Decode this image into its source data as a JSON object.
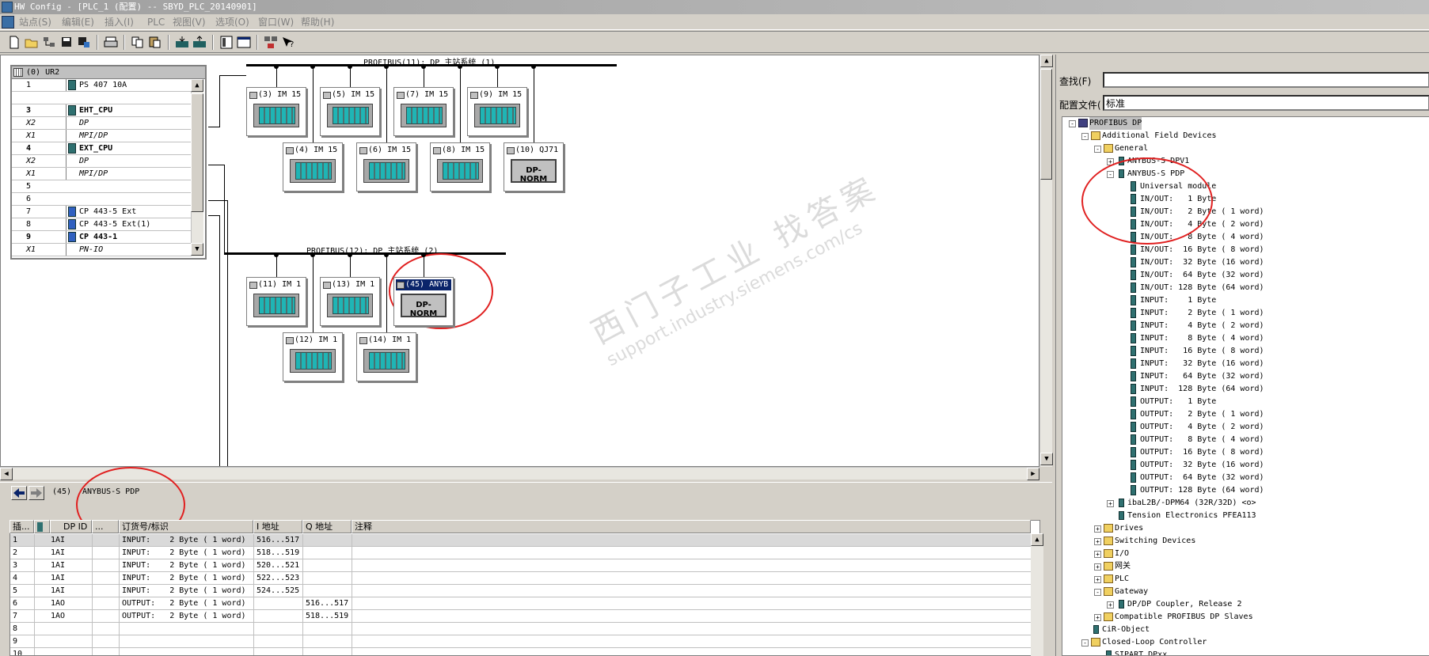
{
  "window": {
    "title": "HW Config - [PLC_1 (配置) -- SBYD_PLC_20140901]"
  },
  "menu": [
    {
      "id": "station",
      "label": "站点(S)"
    },
    {
      "id": "edit",
      "label": "编辑(E)"
    },
    {
      "id": "insert",
      "label": "插入(I)"
    },
    {
      "id": "plc",
      "label": "PLC"
    },
    {
      "id": "view",
      "label": "视图(V)"
    },
    {
      "id": "options",
      "label": "选项(O)"
    },
    {
      "id": "window",
      "label": "窗口(W)"
    },
    {
      "id": "help",
      "label": "帮助(H)"
    }
  ],
  "rack": {
    "title": "(0) UR2",
    "rows": [
      {
        "slot": "1",
        "module": "PS 407 10A"
      },
      {
        "slot": "",
        "module": ""
      },
      {
        "slot": "3",
        "module": "EHT_CPU"
      },
      {
        "slot": "X2",
        "module": "DP"
      },
      {
        "slot": "X1",
        "module": "MPI/DP"
      },
      {
        "slot": "4",
        "module": "EXT_CPU"
      },
      {
        "slot": "X2",
        "module": "DP"
      },
      {
        "slot": "X1",
        "module": "MPI/DP"
      },
      {
        "slot": "5",
        "module": ""
      },
      {
        "slot": "6",
        "module": ""
      },
      {
        "slot": "7",
        "module": "CP 443-5 Ext"
      },
      {
        "slot": "8",
        "module": "CP 443-5 Ext(1)"
      },
      {
        "slot": "9",
        "module": "CP 443-1"
      },
      {
        "slot": "X1",
        "module": "PN-IO"
      }
    ]
  },
  "bus1": {
    "label": "PROFIBUS(11): DP 主站系统 (1)",
    "stations_top": [
      "(3) IM 15",
      "(5) IM 15",
      "(7) IM 15",
      "(9) IM 15"
    ],
    "stations_bottom": [
      "(4) IM 15",
      "(6) IM 15",
      "(8) IM 15",
      "(10) QJ71"
    ],
    "dpnorm_label": "DP-NORM"
  },
  "bus2": {
    "label": "PROFIBUS(12): DP 主站系统 (2)",
    "stations_top": [
      "(11) IM 1",
      "(13) IM 1",
      "(45) ANYB"
    ],
    "stations_bottom": [
      "(12) IM 1",
      "(14) IM 1"
    ],
    "dpnorm_label": "DP-NORM"
  },
  "watermark": {
    "line1": "西门子工业 找答案",
    "line2": "support.industry.siemens.com/cs"
  },
  "detail": {
    "address": "(45)",
    "device": "ANYBUS-S PDP",
    "columns": [
      "插...",
      "DP ID",
      "...",
      "订货号/标识",
      "I 地址",
      "Q 地址",
      "注释"
    ],
    "rows": [
      {
        "n": "1",
        "dpid": "1AI",
        "order": "INPUT:    2 Byte ( 1 word)",
        "i": "516...517",
        "q": ""
      },
      {
        "n": "2",
        "dpid": "1AI",
        "order": "INPUT:    2 Byte ( 1 word)",
        "i": "518...519",
        "q": ""
      },
      {
        "n": "3",
        "dpid": "1AI",
        "order": "INPUT:    2 Byte ( 1 word)",
        "i": "520...521",
        "q": ""
      },
      {
        "n": "4",
        "dpid": "1AI",
        "order": "INPUT:    2 Byte ( 1 word)",
        "i": "522...523",
        "q": ""
      },
      {
        "n": "5",
        "dpid": "1AI",
        "order": "INPUT:    2 Byte ( 1 word)",
        "i": "524...525",
        "q": ""
      },
      {
        "n": "6",
        "dpid": "1AO",
        "order": "OUTPUT:   2 Byte ( 1 word)",
        "i": "",
        "q": "516...517"
      },
      {
        "n": "7",
        "dpid": "1AO",
        "order": "OUTPUT:   2 Byte ( 1 word)",
        "i": "",
        "q": "518...519"
      },
      {
        "n": "8",
        "dpid": "",
        "order": "",
        "i": "",
        "q": ""
      },
      {
        "n": "9",
        "dpid": "",
        "order": "",
        "i": "",
        "q": ""
      },
      {
        "n": "10",
        "dpid": "",
        "order": "",
        "i": "",
        "q": ""
      }
    ]
  },
  "catalog": {
    "find_label": "查找(F)",
    "find_value": "",
    "profile_label": "配置文件(",
    "profile_value": "标准",
    "tree": [
      {
        "label": "PROFIBUS DP",
        "icon": "net",
        "exp": "-"
      },
      {
        "label": "Additional Field Devices",
        "icon": "folder",
        "exp": "-"
      },
      {
        "label": "General",
        "icon": "folder",
        "exp": "-"
      },
      {
        "label": "ANYBUS-S DPV1",
        "icon": "dev",
        "exp": "+"
      },
      {
        "label": "ANYBUS-S PDP",
        "icon": "dev",
        "exp": "-"
      },
      {
        "label": "Universal module",
        "icon": "mod"
      },
      {
        "label": "IN/OUT:   1 Byte",
        "icon": "mod"
      },
      {
        "label": "IN/OUT:   2 Byte ( 1 word)",
        "icon": "mod"
      },
      {
        "label": "IN/OUT:   4 Byte ( 2 word)",
        "icon": "mod"
      },
      {
        "label": "IN/OUT:   8 Byte ( 4 word)",
        "icon": "mod"
      },
      {
        "label": "IN/OUT:  16 Byte ( 8 word)",
        "icon": "mod"
      },
      {
        "label": "IN/OUT:  32 Byte (16 word)",
        "icon": "mod"
      },
      {
        "label": "IN/OUT:  64 Byte (32 word)",
        "icon": "mod"
      },
      {
        "label": "IN/OUT: 128 Byte (64 word)",
        "icon": "mod"
      },
      {
        "label": "INPUT:    1 Byte",
        "icon": "mod"
      },
      {
        "label": "INPUT:    2 Byte ( 1 word)",
        "icon": "mod"
      },
      {
        "label": "INPUT:    4 Byte ( 2 word)",
        "icon": "mod"
      },
      {
        "label": "INPUT:    8 Byte ( 4 word)",
        "icon": "mod"
      },
      {
        "label": "INPUT:   16 Byte ( 8 word)",
        "icon": "mod"
      },
      {
        "label": "INPUT:   32 Byte (16 word)",
        "icon": "mod"
      },
      {
        "label": "INPUT:   64 Byte (32 word)",
        "icon": "mod"
      },
      {
        "label": "INPUT:  128 Byte (64 word)",
        "icon": "mod"
      },
      {
        "label": "OUTPUT:   1 Byte",
        "icon": "mod"
      },
      {
        "label": "OUTPUT:   2 Byte ( 1 word)",
        "icon": "mod"
      },
      {
        "label": "OUTPUT:   4 Byte ( 2 word)",
        "icon": "mod"
      },
      {
        "label": "OUTPUT:   8 Byte ( 4 word)",
        "icon": "mod"
      },
      {
        "label": "OUTPUT:  16 Byte ( 8 word)",
        "icon": "mod"
      },
      {
        "label": "OUTPUT:  32 Byte (16 word)",
        "icon": "mod"
      },
      {
        "label": "OUTPUT:  64 Byte (32 word)",
        "icon": "mod"
      },
      {
        "label": "OUTPUT: 128 Byte (64 word)",
        "icon": "mod"
      },
      {
        "label": "ibaL2B/-DPM64 (32R/32D) <o>",
        "icon": "dev",
        "exp": "+"
      },
      {
        "label": "Tension Electronics PFEA113",
        "icon": "dev"
      },
      {
        "label": "Drives",
        "icon": "folder",
        "exp": "+"
      },
      {
        "label": "Switching Devices",
        "icon": "folder",
        "exp": "+"
      },
      {
        "label": "I/O",
        "icon": "folder",
        "exp": "+"
      },
      {
        "label": "网关",
        "icon": "folder",
        "exp": "+"
      },
      {
        "label": "PLC",
        "icon": "folder",
        "exp": "+"
      },
      {
        "label": "Gateway",
        "icon": "folder",
        "exp": "-"
      },
      {
        "label": "DP/DP Coupler, Release 2",
        "icon": "dev",
        "exp": "+"
      },
      {
        "label": "Compatible PROFIBUS DP Slaves",
        "icon": "folder",
        "exp": "+"
      },
      {
        "label": "CiR-Object",
        "icon": "dev"
      },
      {
        "label": "Closed-Loop Controller",
        "icon": "folder",
        "exp": "-"
      },
      {
        "label": "SIPART DPxx",
        "icon": "dev"
      }
    ]
  },
  "colors": {
    "annotation": "#e02020",
    "selection": "#0a246a",
    "module": "#2f7070"
  }
}
